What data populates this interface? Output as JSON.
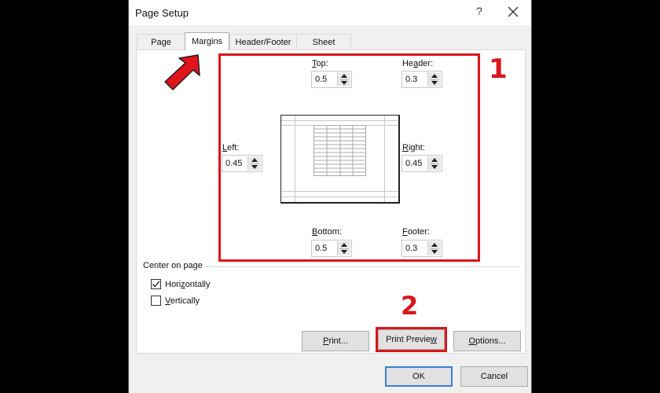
{
  "window": {
    "title": "Page Setup",
    "help_label": "?",
    "close_icon": "close-icon"
  },
  "tabs": [
    {
      "label": "Page",
      "active": false
    },
    {
      "label": "Margins",
      "active": true
    },
    {
      "label": "Header/Footer",
      "active": false
    },
    {
      "label": "Sheet",
      "active": false
    }
  ],
  "margins": {
    "top": {
      "label": "Top:",
      "value": "0.5"
    },
    "header": {
      "label": "Header:",
      "value": "0.3"
    },
    "left": {
      "label": "Left:",
      "value": "0.45"
    },
    "right": {
      "label": "Right:",
      "value": "0.45"
    },
    "bottom": {
      "label": "Bottom:",
      "value": "0.5"
    },
    "footer": {
      "label": "Footer:",
      "value": "0.3"
    }
  },
  "center_on_page": {
    "label": "Center on page",
    "horizontally": {
      "label": "Horizontally",
      "checked": true
    },
    "vertically": {
      "label": "Vertically",
      "checked": false
    }
  },
  "buttons": {
    "print": "Print...",
    "print_preview": "Print Preview",
    "options": "Options...",
    "ok": "OK",
    "cancel": "Cancel"
  },
  "annotations": {
    "step1": "1",
    "step2": "2",
    "accent_color": "#d9161c"
  }
}
